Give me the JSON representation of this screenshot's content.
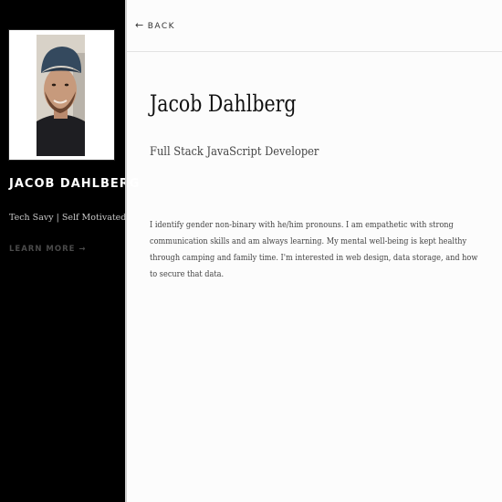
{
  "nav": {
    "back_arrow": "←",
    "back_label": "BACK"
  },
  "sidebar": {
    "name": "JACOB DAHLBERG",
    "tagline": "Tech Savy | Self Motivated",
    "learn_more": "LEARN MORE →"
  },
  "main": {
    "title": "Jacob Dahlberg",
    "subtitle": "Full Stack JavaScript Developer",
    "bio": "I identify gender non-binary with he/him pronouns. I am empathetic with strong communication skills and am always learning. My mental well-being is kept healthy through camping and family time. I'm interested in web design, data storage, and how to secure that data."
  },
  "colors": {
    "sidebar_bg": "#000000",
    "page_bg": "#fcfcfc",
    "text_dark": "#111111",
    "text_muted": "#444444"
  }
}
